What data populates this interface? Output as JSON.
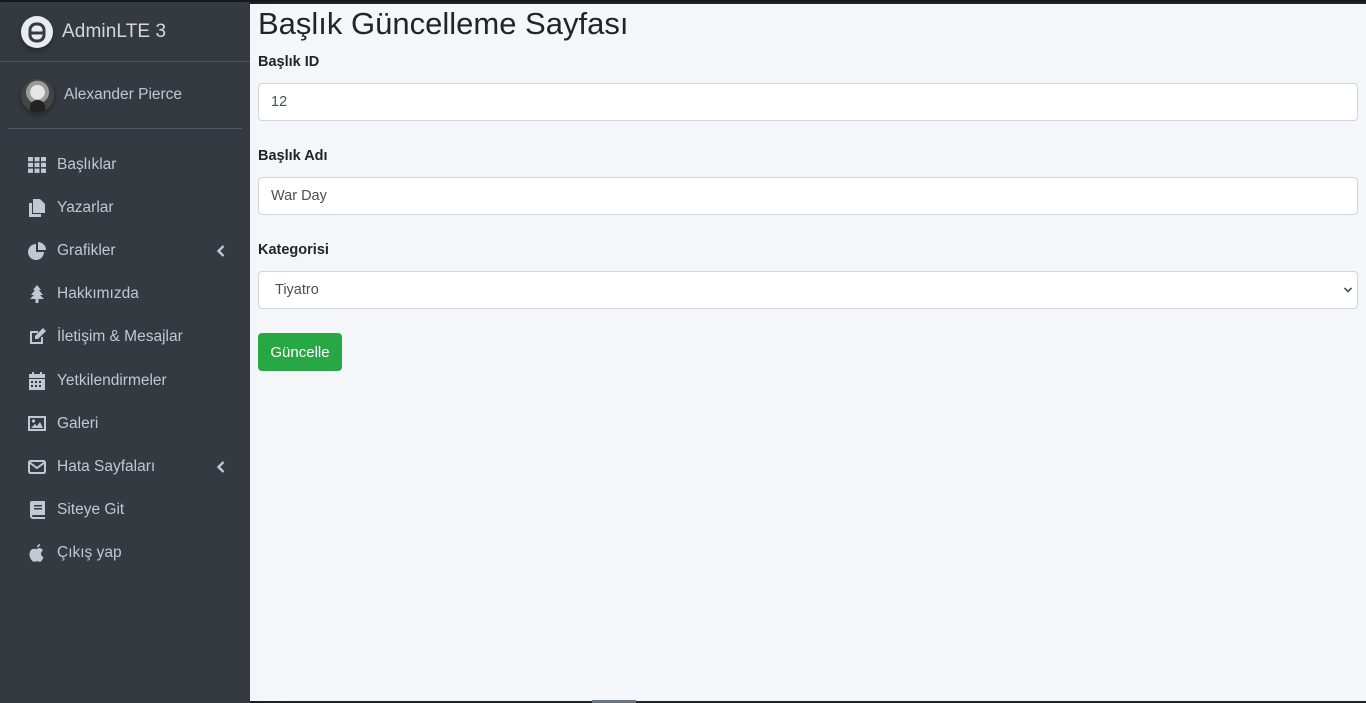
{
  "brand": {
    "name": "AdminLTE 3",
    "logo_icon": "adminlte-logo-icon"
  },
  "user": {
    "name": "Alexander Pierce"
  },
  "sidebar": {
    "items": [
      {
        "label": "Başlıklar",
        "icon": "th-grid-icon",
        "has_arrow": false
      },
      {
        "label": "Yazarlar",
        "icon": "copy-icon",
        "has_arrow": false
      },
      {
        "label": "Grafikler",
        "icon": "chart-pie-icon",
        "has_arrow": true
      },
      {
        "label": "Hakkımızda",
        "icon": "tree-icon",
        "has_arrow": false
      },
      {
        "label": "İletişim & Mesajlar",
        "icon": "edit-icon",
        "has_arrow": false
      },
      {
        "label": "Yetkilendirmeler",
        "icon": "calendar-icon",
        "has_arrow": false
      },
      {
        "label": "Galeri",
        "icon": "image-icon",
        "has_arrow": false
      },
      {
        "label": "Hata Sayfaları",
        "icon": "envelope-icon",
        "has_arrow": true
      },
      {
        "label": "Siteye Git",
        "icon": "book-icon",
        "has_arrow": false
      },
      {
        "label": "Çıkış yap",
        "icon": "apple-icon",
        "has_arrow": false
      }
    ]
  },
  "main": {
    "title": "Başlık Güncelleme Sayfası",
    "form": {
      "id_label": "Başlık ID",
      "id_value": "12",
      "name_label": "Başlık Adı",
      "name_value": "War Day",
      "category_label": "Kategorisi",
      "category_selected": "Tiyatro",
      "submit_label": "Güncelle"
    }
  },
  "colors": {
    "sidebar_bg": "#343a40",
    "content_bg": "#f4f6f9",
    "success": "#28a745",
    "sidebar_text": "#c2c7d0"
  }
}
